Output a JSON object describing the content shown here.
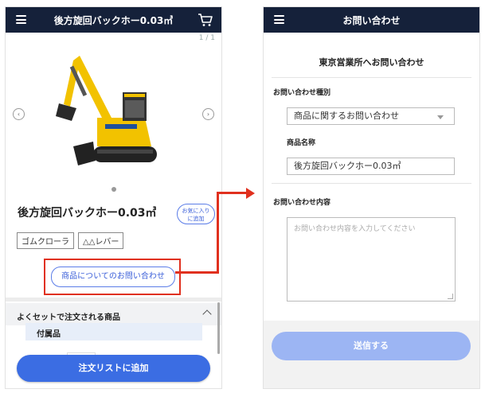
{
  "left": {
    "header_title": "後方旋回バックホー0.03㎥",
    "pager": "1 / 1",
    "product_title": "後方旋回バックホー0.03㎥",
    "favorite_label": "お気に入り\nに追加",
    "tags": [
      "ゴムクローラ",
      "△△レバー"
    ],
    "inquiry_button": "商品についてのお問い合わせ",
    "set_section_title": "よくセットで注文される商品",
    "accessory_label": "付属品",
    "add_to_cart": "注文リストに追加",
    "icons": [
      "menu-icon",
      "cart-icon",
      "chevron-left-icon",
      "chevron-right-icon",
      "chevron-up-icon"
    ]
  },
  "right": {
    "header_title": "お問い合わせ",
    "office_heading": "東京営業所へお問い合わせ",
    "type_label": "お問い合わせ種別",
    "type_value": "商品に関するお問い合わせ",
    "product_name_label": "商品名称",
    "product_name_value": "後方旋回バックホー0.03㎥",
    "content_label": "お問い合わせ内容",
    "content_placeholder": "お問い合わせ内容を入力してください",
    "submit_label": "送信する"
  },
  "colors": {
    "header_bg": "#15213a",
    "accent_blue": "#3b6de3",
    "submit_disabled": "#9cb5f3",
    "highlight_red": "#e0301e",
    "excavator_yellow": "#f2c200"
  }
}
